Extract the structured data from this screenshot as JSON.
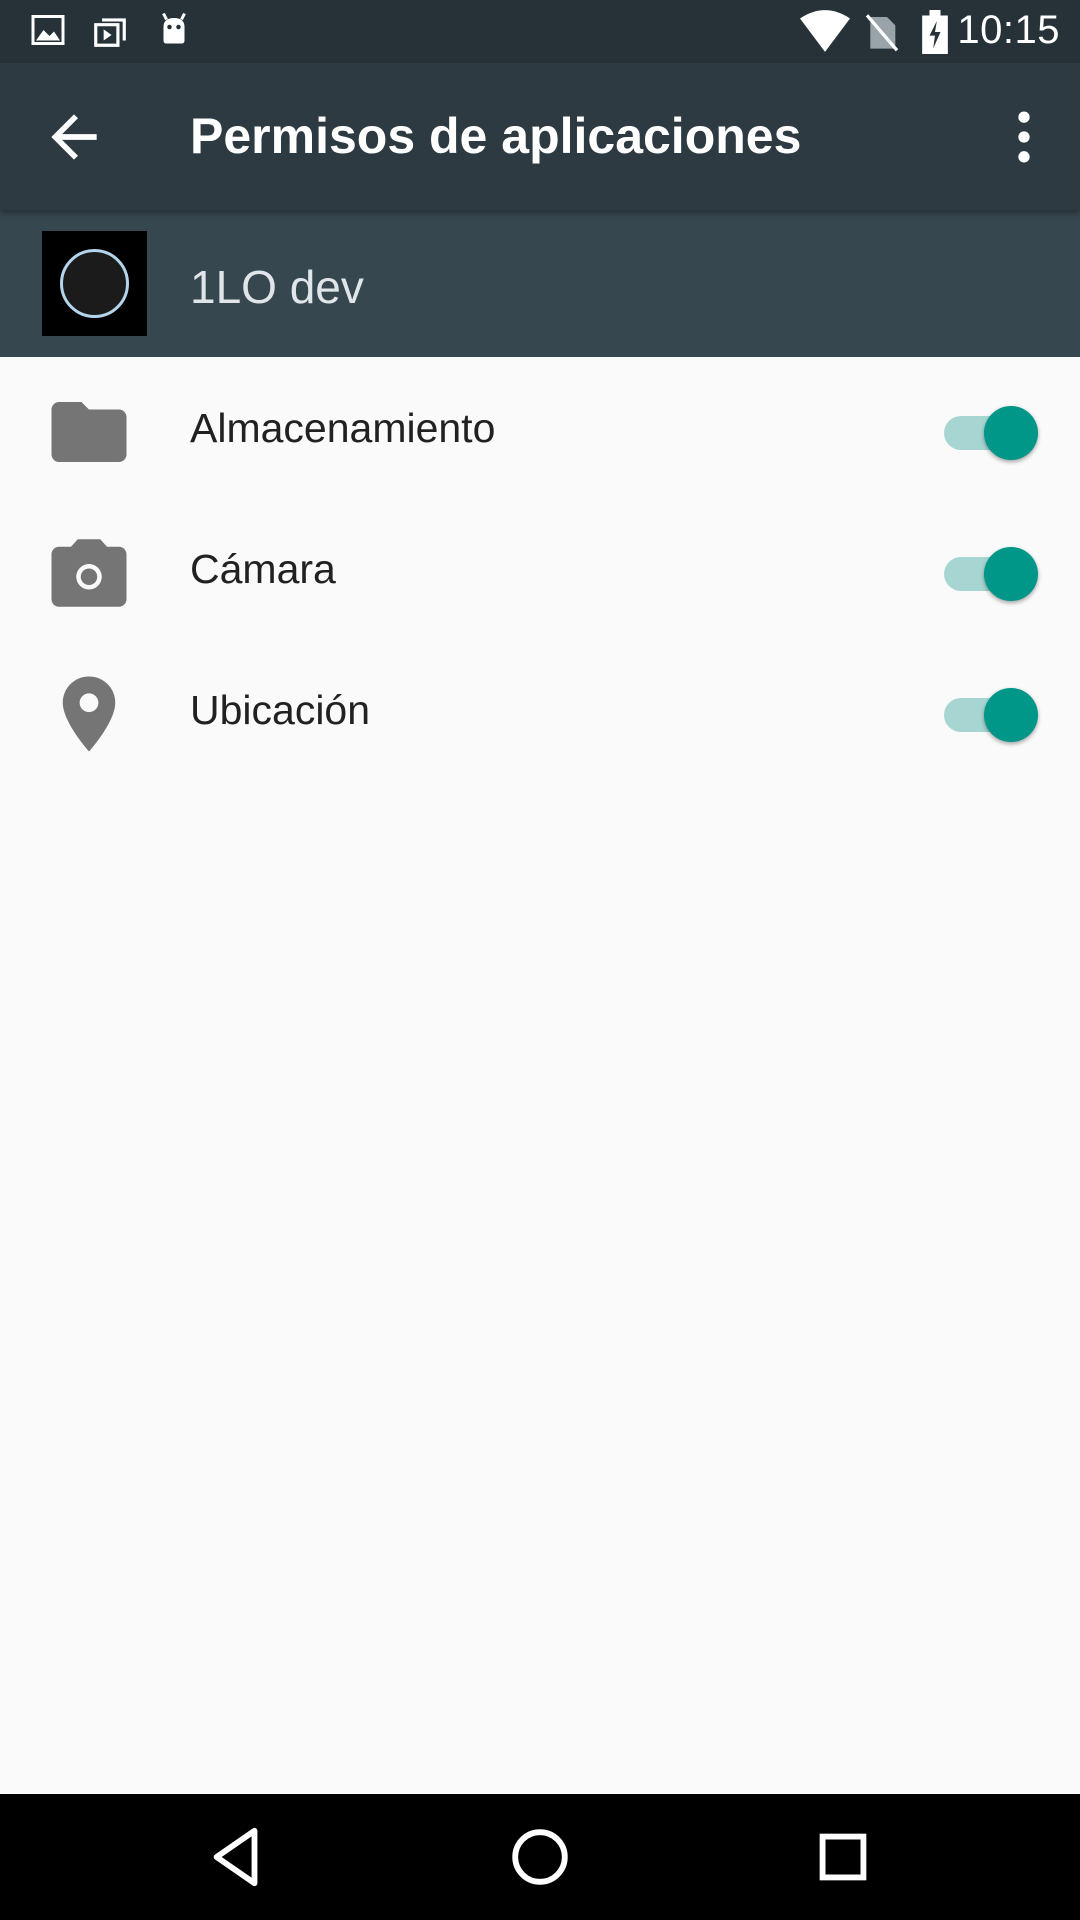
{
  "status_bar": {
    "time": "10:15",
    "left_icons": [
      "image-icon",
      "play-store-icon",
      "android-icon"
    ],
    "right_icons": [
      "wifi-icon",
      "no-sim-icon",
      "battery-charging-icon"
    ]
  },
  "toolbar": {
    "title": "Permisos de aplicaciones",
    "back_icon": "arrow-back-icon",
    "more_icon": "more-vert-icon"
  },
  "app": {
    "name": "1LO dev"
  },
  "permissions": [
    {
      "label": "Almacenamiento",
      "icon": "folder-icon",
      "enabled": true
    },
    {
      "label": "Cámara",
      "icon": "camera-icon",
      "enabled": true
    },
    {
      "label": "Ubicación",
      "icon": "location-pin-icon",
      "enabled": true
    }
  ],
  "nav_bar": {
    "icons": [
      "back-triangle-icon",
      "home-circle-icon",
      "recents-square-icon"
    ]
  },
  "colors": {
    "status_bar": "#263238",
    "toolbar": "#2d3a41",
    "app_header": "#37474f",
    "background": "#fafafa",
    "accent": "#009688",
    "accent_track": "#a7d6d2",
    "icon_gray": "#757575"
  }
}
